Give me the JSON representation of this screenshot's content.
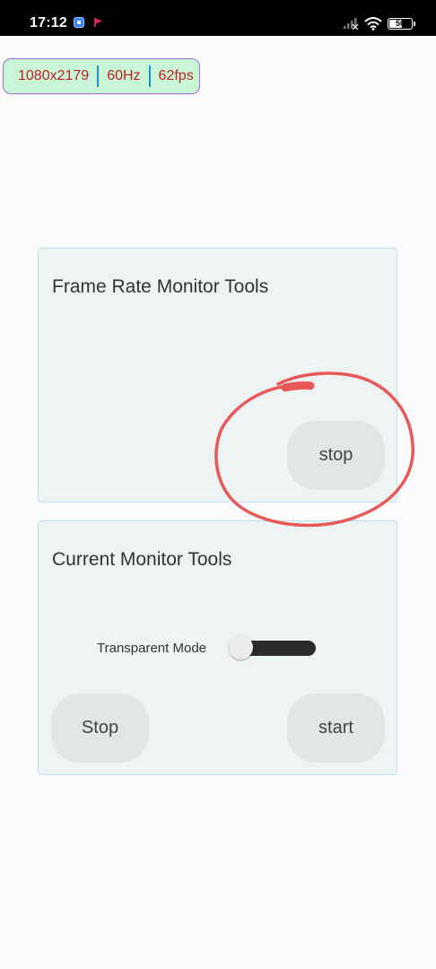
{
  "status_bar": {
    "time": "17:12",
    "battery": "50",
    "icons": [
      "app-notification-icon",
      "flag-notification-icon",
      "signal-icon",
      "wifi-icon",
      "battery-icon"
    ]
  },
  "fps_overlay": {
    "resolution": "1080x2179",
    "refresh_rate": "60Hz",
    "fps": "62fps"
  },
  "frame_rate_card": {
    "title": "Frame Rate Monitor Tools",
    "stop_button": "stop"
  },
  "current_card": {
    "title": "Current Monitor Tools",
    "toggle_label": "Transparent Mode",
    "toggle_on": false,
    "stop_button": "Stop",
    "start_button": "start"
  },
  "colors": {
    "overlay_background": "#c9f5d9",
    "overlay_text": "#c02020",
    "card_background": "#eef4f3",
    "annotation_stroke": "#e85858"
  }
}
